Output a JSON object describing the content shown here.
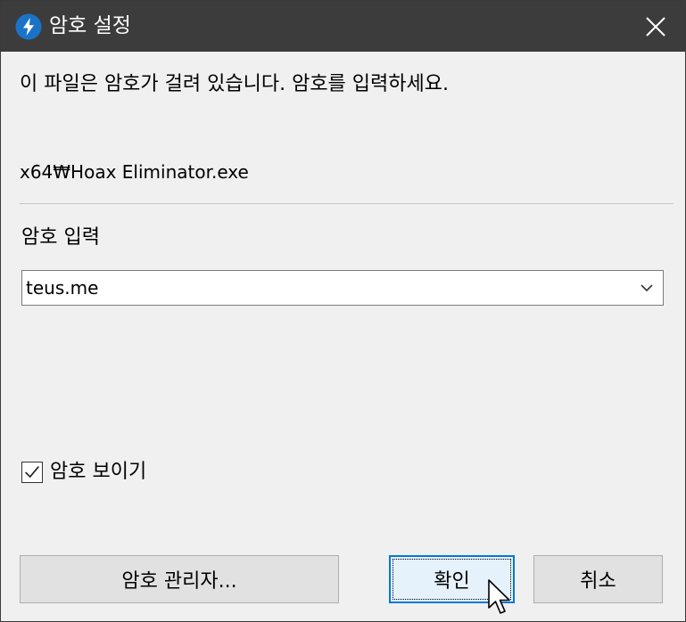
{
  "window": {
    "title": "암호 설정",
    "app_icon": "lightning-bolt-icon",
    "close_icon": "close-icon"
  },
  "content": {
    "message": "이 파일은 암호가 걸려 있습니다. 암호를 입력하세요.",
    "file_path": "x64₩Hoax Eliminator.exe",
    "password_label": "암호 입력",
    "password_value": "teus.me",
    "dropdown_icon": "chevron-down-icon"
  },
  "options": {
    "show_password_label": "암호 보이기",
    "show_password_checked": true
  },
  "buttons": {
    "manager_label": "암호 관리자...",
    "ok_label": "확인",
    "cancel_label": "취소"
  },
  "colors": {
    "titlebar": "#3c3c3c",
    "accent": "#0078d7",
    "icon_circle": "#1a73c9"
  }
}
